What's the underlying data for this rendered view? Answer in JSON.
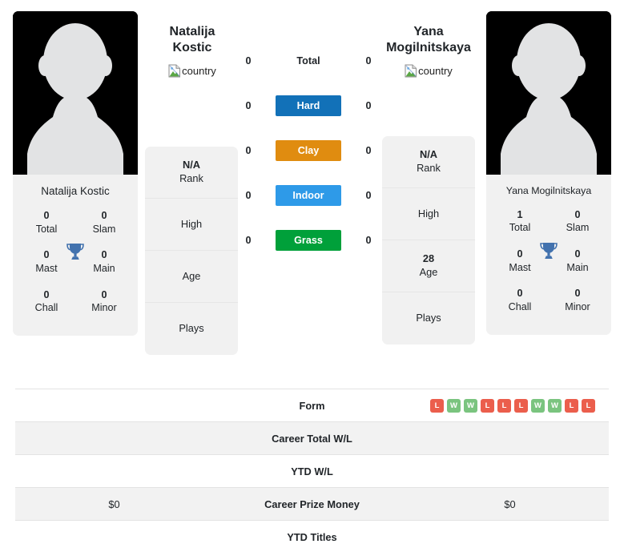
{
  "players": {
    "left": {
      "heading_lines": [
        "Natalija",
        "Kostic"
      ],
      "country_alt": "country",
      "card_name": "Natalija Kostic",
      "titles": [
        {
          "value": "0",
          "label": "Total"
        },
        {
          "value": "0",
          "label": "Slam"
        },
        {
          "value": "0",
          "label": "Mast"
        },
        {
          "value": "0",
          "label": "Main"
        },
        {
          "value": "0",
          "label": "Chall"
        },
        {
          "value": "0",
          "label": "Minor"
        }
      ],
      "info": [
        {
          "value": "N/A",
          "label": "Rank"
        },
        {
          "value": "",
          "label": "High"
        },
        {
          "value": "",
          "label": "Age"
        },
        {
          "value": "",
          "label": "Plays"
        }
      ]
    },
    "right": {
      "heading_lines": [
        "Yana",
        "Mogilnitskaya"
      ],
      "country_alt": "country",
      "card_name": "Yana Mogilnitskaya",
      "titles": [
        {
          "value": "1",
          "label": "Total"
        },
        {
          "value": "0",
          "label": "Slam"
        },
        {
          "value": "0",
          "label": "Mast"
        },
        {
          "value": "0",
          "label": "Main"
        },
        {
          "value": "0",
          "label": "Chall"
        },
        {
          "value": "0",
          "label": "Minor"
        }
      ],
      "info": [
        {
          "value": "N/A",
          "label": "Rank"
        },
        {
          "value": "",
          "label": "High"
        },
        {
          "value": "28",
          "label": "Age"
        },
        {
          "value": "",
          "label": "Plays"
        }
      ]
    }
  },
  "surfaces": [
    {
      "label": "Total",
      "left": "0",
      "right": "0",
      "color": "transparent",
      "plain": true
    },
    {
      "label": "Hard",
      "left": "0",
      "right": "0",
      "color": "#1271b8"
    },
    {
      "label": "Clay",
      "left": "0",
      "right": "0",
      "color": "#e08c10"
    },
    {
      "label": "Indoor",
      "left": "0",
      "right": "0",
      "color": "#2e9ae8"
    },
    {
      "label": "Grass",
      "left": "0",
      "right": "0",
      "color": "#00a03a"
    }
  ],
  "comparison_rows": [
    {
      "label": "Form",
      "left": "",
      "right": "",
      "shaded": false,
      "right_form": [
        "L",
        "W",
        "W",
        "L",
        "L",
        "L",
        "W",
        "W",
        "L",
        "L"
      ]
    },
    {
      "label": "Career Total W/L",
      "left": "",
      "right": "",
      "shaded": true
    },
    {
      "label": "YTD W/L",
      "left": "",
      "right": "",
      "shaded": false
    },
    {
      "label": "Career Prize Money",
      "left": "$0",
      "right": "$0",
      "shaded": true
    },
    {
      "label": "YTD Titles",
      "left": "",
      "right": "",
      "shaded": false
    }
  ],
  "colors": {
    "win": "#7ac47f",
    "loss": "#eb5e4c",
    "trophy": "#4272ae",
    "card_bg": "#f1f1f1",
    "row_shaded": "#f2f2f2"
  },
  "icons": {
    "trophy": "trophy-icon",
    "broken_image": "broken-image-icon"
  }
}
